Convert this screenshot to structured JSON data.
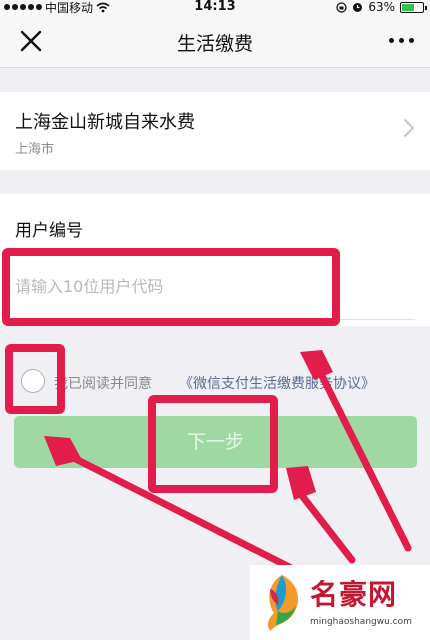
{
  "status_bar": {
    "carrier": "中国移动",
    "time": "14:13",
    "battery_percent": "63%",
    "battery_level": 0.63
  },
  "navbar": {
    "title": "生活缴费",
    "close_icon": "close-icon",
    "more_icon": "more-icon"
  },
  "biller": {
    "name": "上海金山新城自来水费",
    "city": "上海市"
  },
  "form": {
    "label": "用户编号",
    "placeholder": "请输入10位用户代码",
    "value": ""
  },
  "agreement": {
    "text": "我已阅读并同意",
    "link": "《微信支付生活缴费服务协议》",
    "checked": false
  },
  "next_button": {
    "label": "下一步"
  },
  "annotation_color": "#e21c4b",
  "watermark": {
    "name": "名豪网",
    "domain": "minghaoshangwu.com"
  }
}
